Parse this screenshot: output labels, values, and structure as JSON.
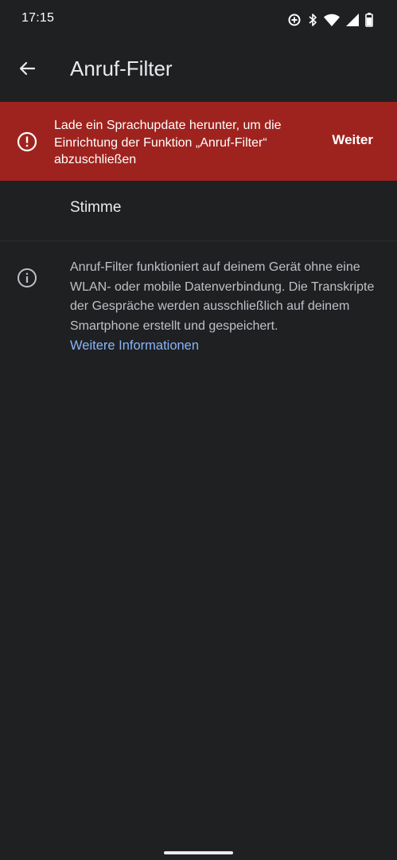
{
  "status_bar": {
    "time": "17:15",
    "icons": [
      "data-saver-icon",
      "bluetooth-icon",
      "wifi-icon",
      "cellular-signal-icon",
      "battery-icon"
    ]
  },
  "app_bar": {
    "back_icon": "arrow-back-icon",
    "title": "Anruf-Filter"
  },
  "banner": {
    "icon": "error-outline-icon",
    "message": "Lade ein Sprachupdate herunter, um die Einrichtung der Funktion „Anruf-Filter“ abzuschließen",
    "action_label": "Weiter",
    "background_color": "#9e231e"
  },
  "settings": {
    "items": [
      {
        "label": "Stimme"
      }
    ]
  },
  "info": {
    "icon": "info-outline-icon",
    "text": "Anruf-Filter funktioniert auf deinem Gerät ohne eine WLAN- oder mobile Datenverbindung. Die Transkripte der Gespräche werden ausschließlich auf deinem Smartphone erstellt und gespeichert.",
    "link_label": "Weitere Informationen",
    "link_color": "#8ab4f8"
  }
}
